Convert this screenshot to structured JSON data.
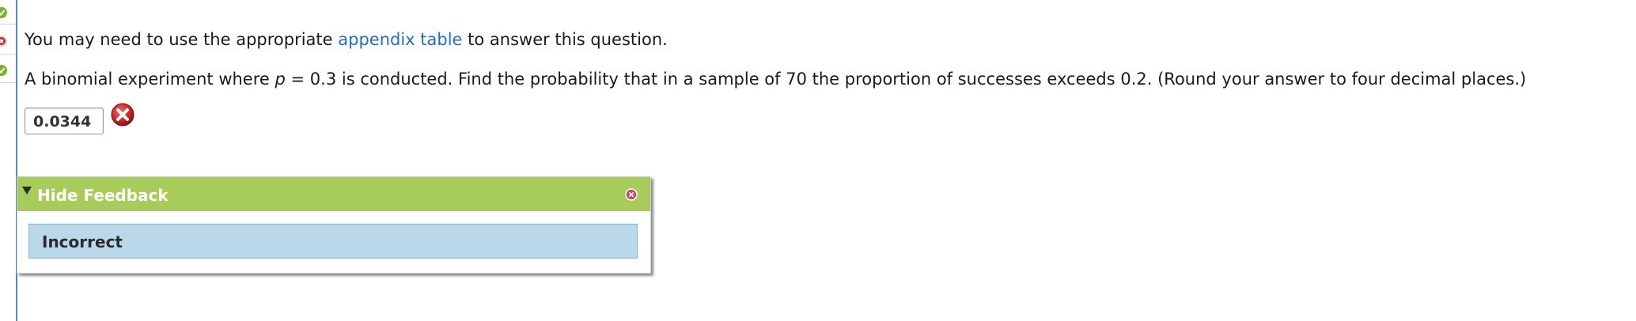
{
  "question": {
    "intro_prefix": "You may need to use the appropriate ",
    "intro_link": "appendix table",
    "intro_suffix": " to answer this question.",
    "prompt_prefix": "A binomial experiment where ",
    "prompt_var": "p",
    "prompt_suffix": " = 0.3 is conducted. Find the probability that in a sample of 70 the proportion of successes exceeds 0.2. (Round your answer to four decimal places.)"
  },
  "answer": {
    "value": "0.0344",
    "status": "incorrect"
  },
  "feedback": {
    "toggle_label": "Hide Feedback",
    "result": "Incorrect"
  },
  "gutter": {
    "markers": [
      "correct",
      "incorrect",
      "correct"
    ]
  },
  "colors": {
    "link": "#1f6fc4",
    "feedback_header": "#a8cc5a",
    "feedback_body": "#b9d9ea",
    "correct": "#7bb22d",
    "incorrect": "#cc2b2b"
  }
}
